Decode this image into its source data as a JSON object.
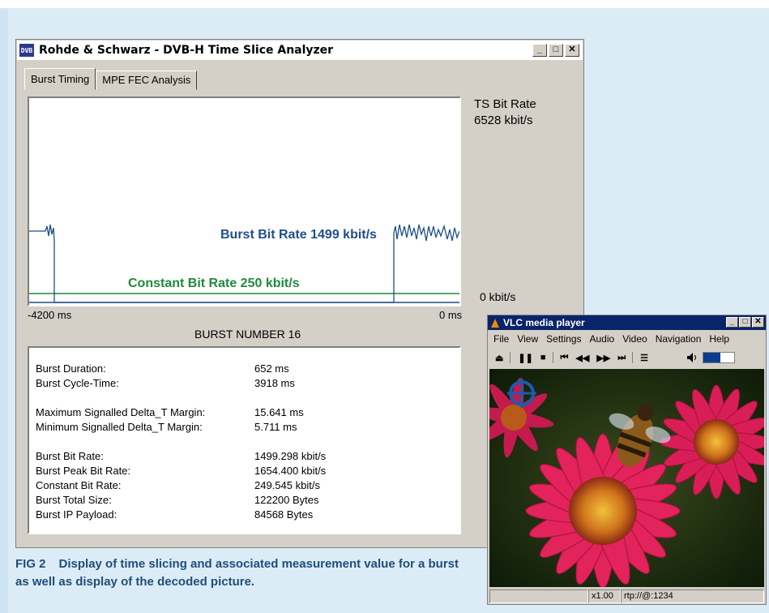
{
  "analyzer": {
    "window_title": "Rohde & Schwarz - DVB-H Time Slice Analyzer",
    "icon_text": "DVB",
    "controls": {
      "minimize": "_",
      "maximize": "□",
      "close": "✕"
    },
    "tabs": [
      {
        "label": "Burst Timing",
        "active": true
      },
      {
        "label": "MPE FEC Analysis",
        "active": false
      }
    ],
    "ts_bit_rate_label": "TS Bit Rate",
    "ts_bit_rate_value": "6528 kbit/s",
    "zero_label": "0 kbit/s",
    "axis_start": "-4200 ms",
    "axis_end": "0 ms",
    "burst_bit_rate_label": "Burst Bit Rate 1499 kbit/s",
    "constant_bit_rate_label": "Constant Bit Rate 250 kbit/s",
    "burst_number": "BURST NUMBER 16",
    "measurements": [
      {
        "label": "Burst Duration:",
        "value": "652 ms"
      },
      {
        "label": "Burst Cycle-Time:",
        "value": "3918 ms"
      },
      {
        "label": "Maximum Signalled Delta_T Margin:",
        "value": "15.641 ms"
      },
      {
        "label": "Minimum Signalled Delta_T Margin:",
        "value": "5.711 ms"
      },
      {
        "label": "Burst Bit Rate:",
        "value": "1499.298 kbit/s"
      },
      {
        "label": "Burst Peak Bit Rate:",
        "value": "1654.400 kbit/s"
      },
      {
        "label": "Constant Bit Rate:",
        "value": "249.545 kbit/s"
      },
      {
        "label": "Burst Total Size:",
        "value": "122200 Bytes"
      },
      {
        "label": "Burst IP Payload:",
        "value": "84568 Bytes"
      }
    ],
    "colors": {
      "burst": "#1f4e8c",
      "constant": "#1f8a3c"
    }
  },
  "vlc": {
    "window_title": "VLC media player",
    "controls": {
      "minimize": "_",
      "maximize": "□",
      "close": "✕"
    },
    "menu": [
      "File",
      "View",
      "Settings",
      "Audio",
      "Video",
      "Navigation",
      "Help"
    ],
    "toolbar": [
      "⏏",
      "❚❚",
      "■",
      "⏮",
      "◀◀",
      "▶▶",
      "⏭",
      "☰"
    ],
    "volume_icon": "speaker-icon",
    "volume_level": 0.55,
    "status": {
      "speed": "x1.00",
      "stream": "rtp://@:1234"
    }
  },
  "caption": {
    "fig": "FIG 2",
    "text": "Display of time slicing and associated measurement value for a burst as well as display of the decoded picture."
  }
}
